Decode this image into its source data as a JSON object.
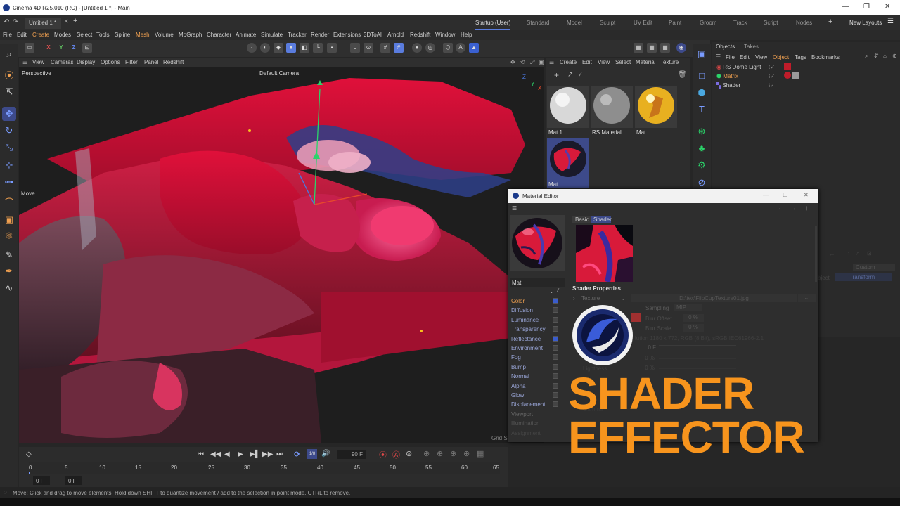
{
  "window": {
    "title": "Cinema 4D R25.010 (RC) - [Untitled 1 *] - Main",
    "doc_tab": "Untitled 1 *"
  },
  "layouts": [
    "Startup (User)",
    "Standard",
    "Model",
    "Sculpt",
    "UV Edit",
    "Paint",
    "Groom",
    "Track",
    "Script",
    "Nodes"
  ],
  "new_layouts": "New Layouts",
  "menu": [
    "File",
    "Edit",
    "Create",
    "Modes",
    "Select",
    "Tools",
    "Spline",
    "Mesh",
    "Volume",
    "MoGraph",
    "Character",
    "Animate",
    "Simulate",
    "Tracker",
    "Render",
    "Extensions",
    "3DToAll",
    "Arnold",
    "Redshift",
    "Window",
    "Help"
  ],
  "toolbar": {
    "x": "X",
    "y": "Y",
    "z": "Z"
  },
  "viewport": {
    "menu": [
      "View",
      "Cameras",
      "Display",
      "Options",
      "Filter",
      "Panel",
      "Redshift"
    ],
    "label": "Perspective",
    "camera": "Default Camera",
    "move_label": "Move",
    "grid": "Grid Sp"
  },
  "materials": {
    "menu": [
      "Create",
      "Edit",
      "View",
      "Select",
      "Material",
      "Texture"
    ],
    "items": [
      {
        "name": "Mat.1"
      },
      {
        "name": "RS Material"
      },
      {
        "name": "Mat"
      },
      {
        "name": "Mat"
      }
    ]
  },
  "objects": {
    "tabs": [
      "Objects",
      "Takes"
    ],
    "menu": [
      "File",
      "Edit",
      "View",
      "Object",
      "Tags",
      "Bookmarks"
    ],
    "rows": [
      "RS Dome Light",
      "Matrix",
      "Shader"
    ],
    "faded": [
      "Custom",
      "Transform",
      "bject"
    ]
  },
  "material_editor": {
    "title": "Material Editor",
    "mat_name": "Mat",
    "tabs": [
      "Basic",
      "Shader"
    ],
    "section": "Shader Properties",
    "texture_label": "Texture",
    "texture_path": "D:\\tex\\FlipCupTexture01.jpg",
    "sampling_label": "Sampling",
    "sampling_value": "MIP",
    "blur_offset": "Blur Offset",
    "blur_offset_val": "0 %",
    "blur_scale": "Blur Scale",
    "blur_scale_val": "0 %",
    "resolution": "lution 1180 x 772, RGB (8 Bit), sRGB IEC61966-2.1",
    "time_val": "0 F",
    "lightness": "Lightness",
    "lightness_val": "0 %",
    "val2": "0 %",
    "gamma": "Gamma",
    "channels": [
      "Color",
      "Diffusion",
      "Luminance",
      "Transparency",
      "Reflectance",
      "Environment",
      "Fog",
      "Bump",
      "Normal",
      "Alpha",
      "Glow",
      "Displacement",
      "Viewport",
      "Illumination",
      "Assignment"
    ],
    "channels_on": [
      true,
      false,
      false,
      false,
      true,
      false,
      false,
      false,
      false,
      false,
      false,
      false,
      false,
      false,
      false
    ]
  },
  "timeline": {
    "ticks": [
      "0",
      "5",
      "10",
      "15",
      "20",
      "25",
      "30",
      "35",
      "40",
      "45",
      "50",
      "55",
      "60",
      "65"
    ],
    "frame_a": "0 F",
    "frame_b": "0 F",
    "end": "90 F",
    "marker": "1/8"
  },
  "status": "Move: Click and drag to move elements. Hold down SHIFT to quantize movement / add to the selection in point mode, CTRL to remove.",
  "promo": {
    "line1": "SHADER",
    "line2": "EFFECTOR"
  },
  "colors": {
    "accent": "#5a7cde",
    "promo": "#f7941d",
    "terrain": "#d0103a"
  }
}
